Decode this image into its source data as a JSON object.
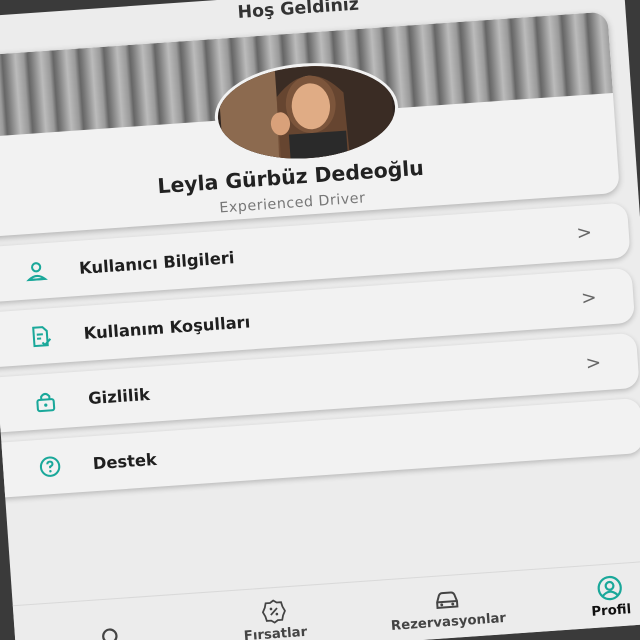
{
  "header": {
    "title": "Hoş Geldiniz"
  },
  "profile": {
    "name": "Leyla Gürbüz Dedeoğlu",
    "role": "Experienced Driver"
  },
  "menu": {
    "items": [
      {
        "label": "Kullanıcı Bilgileri",
        "icon": "user-icon"
      },
      {
        "label": "Kullanım Koşulları",
        "icon": "document-check-icon"
      },
      {
        "label": "Gizlilik",
        "icon": "lock-icon"
      },
      {
        "label": "Destek",
        "icon": "help-circle-icon"
      }
    ],
    "chevron": ">"
  },
  "bottom_nav": {
    "items": [
      {
        "label": "",
        "icon": "search-icon"
      },
      {
        "label": "Fırsatlar",
        "icon": "discount-badge-icon"
      },
      {
        "label": "Rezervasyonlar",
        "icon": "car-icon"
      },
      {
        "label": "Profil",
        "icon": "profile-icon",
        "active": true
      }
    ]
  },
  "colors": {
    "accent": "#1aa89a",
    "background": "#ececec",
    "card": "#f2f2f2",
    "text": "#1f1f1f",
    "muted": "#777777"
  }
}
